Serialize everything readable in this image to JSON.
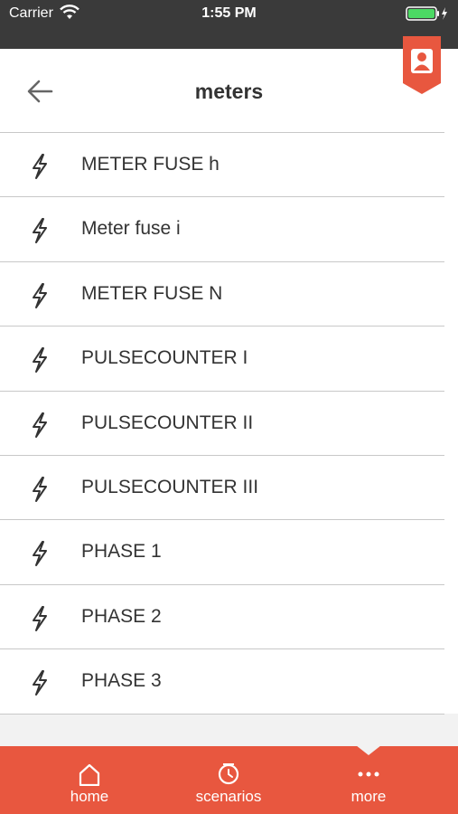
{
  "status_bar": {
    "carrier": "Carrier",
    "time": "1:55 PM"
  },
  "header": {
    "title": "meters"
  },
  "meters": [
    {
      "label": "METER FUSE h",
      "icon": "lightning-icon"
    },
    {
      "label": "Meter fuse i",
      "icon": "lightning-icon"
    },
    {
      "label": "METER FUSE N",
      "icon": "lightning-icon"
    },
    {
      "label": "PULSECOUNTER I",
      "icon": "lightning-icon"
    },
    {
      "label": "PULSECOUNTER II",
      "icon": "lightning-icon"
    },
    {
      "label": "PULSECOUNTER III",
      "icon": "lightning-icon"
    },
    {
      "label": "PHASE 1",
      "icon": "lightning-icon"
    },
    {
      "label": "PHASE 2",
      "icon": "lightning-icon"
    },
    {
      "label": "PHASE 3",
      "icon": "lightning-icon"
    }
  ],
  "tab_bar": {
    "tabs": [
      {
        "label": "home",
        "icon": "home-icon"
      },
      {
        "label": "scenarios",
        "icon": "clock-icon"
      },
      {
        "label": "more",
        "icon": "more-icon"
      }
    ]
  },
  "colors": {
    "accent": "#e8573f",
    "status_bar": "#3a3a3a",
    "battery": "#4cd964"
  }
}
